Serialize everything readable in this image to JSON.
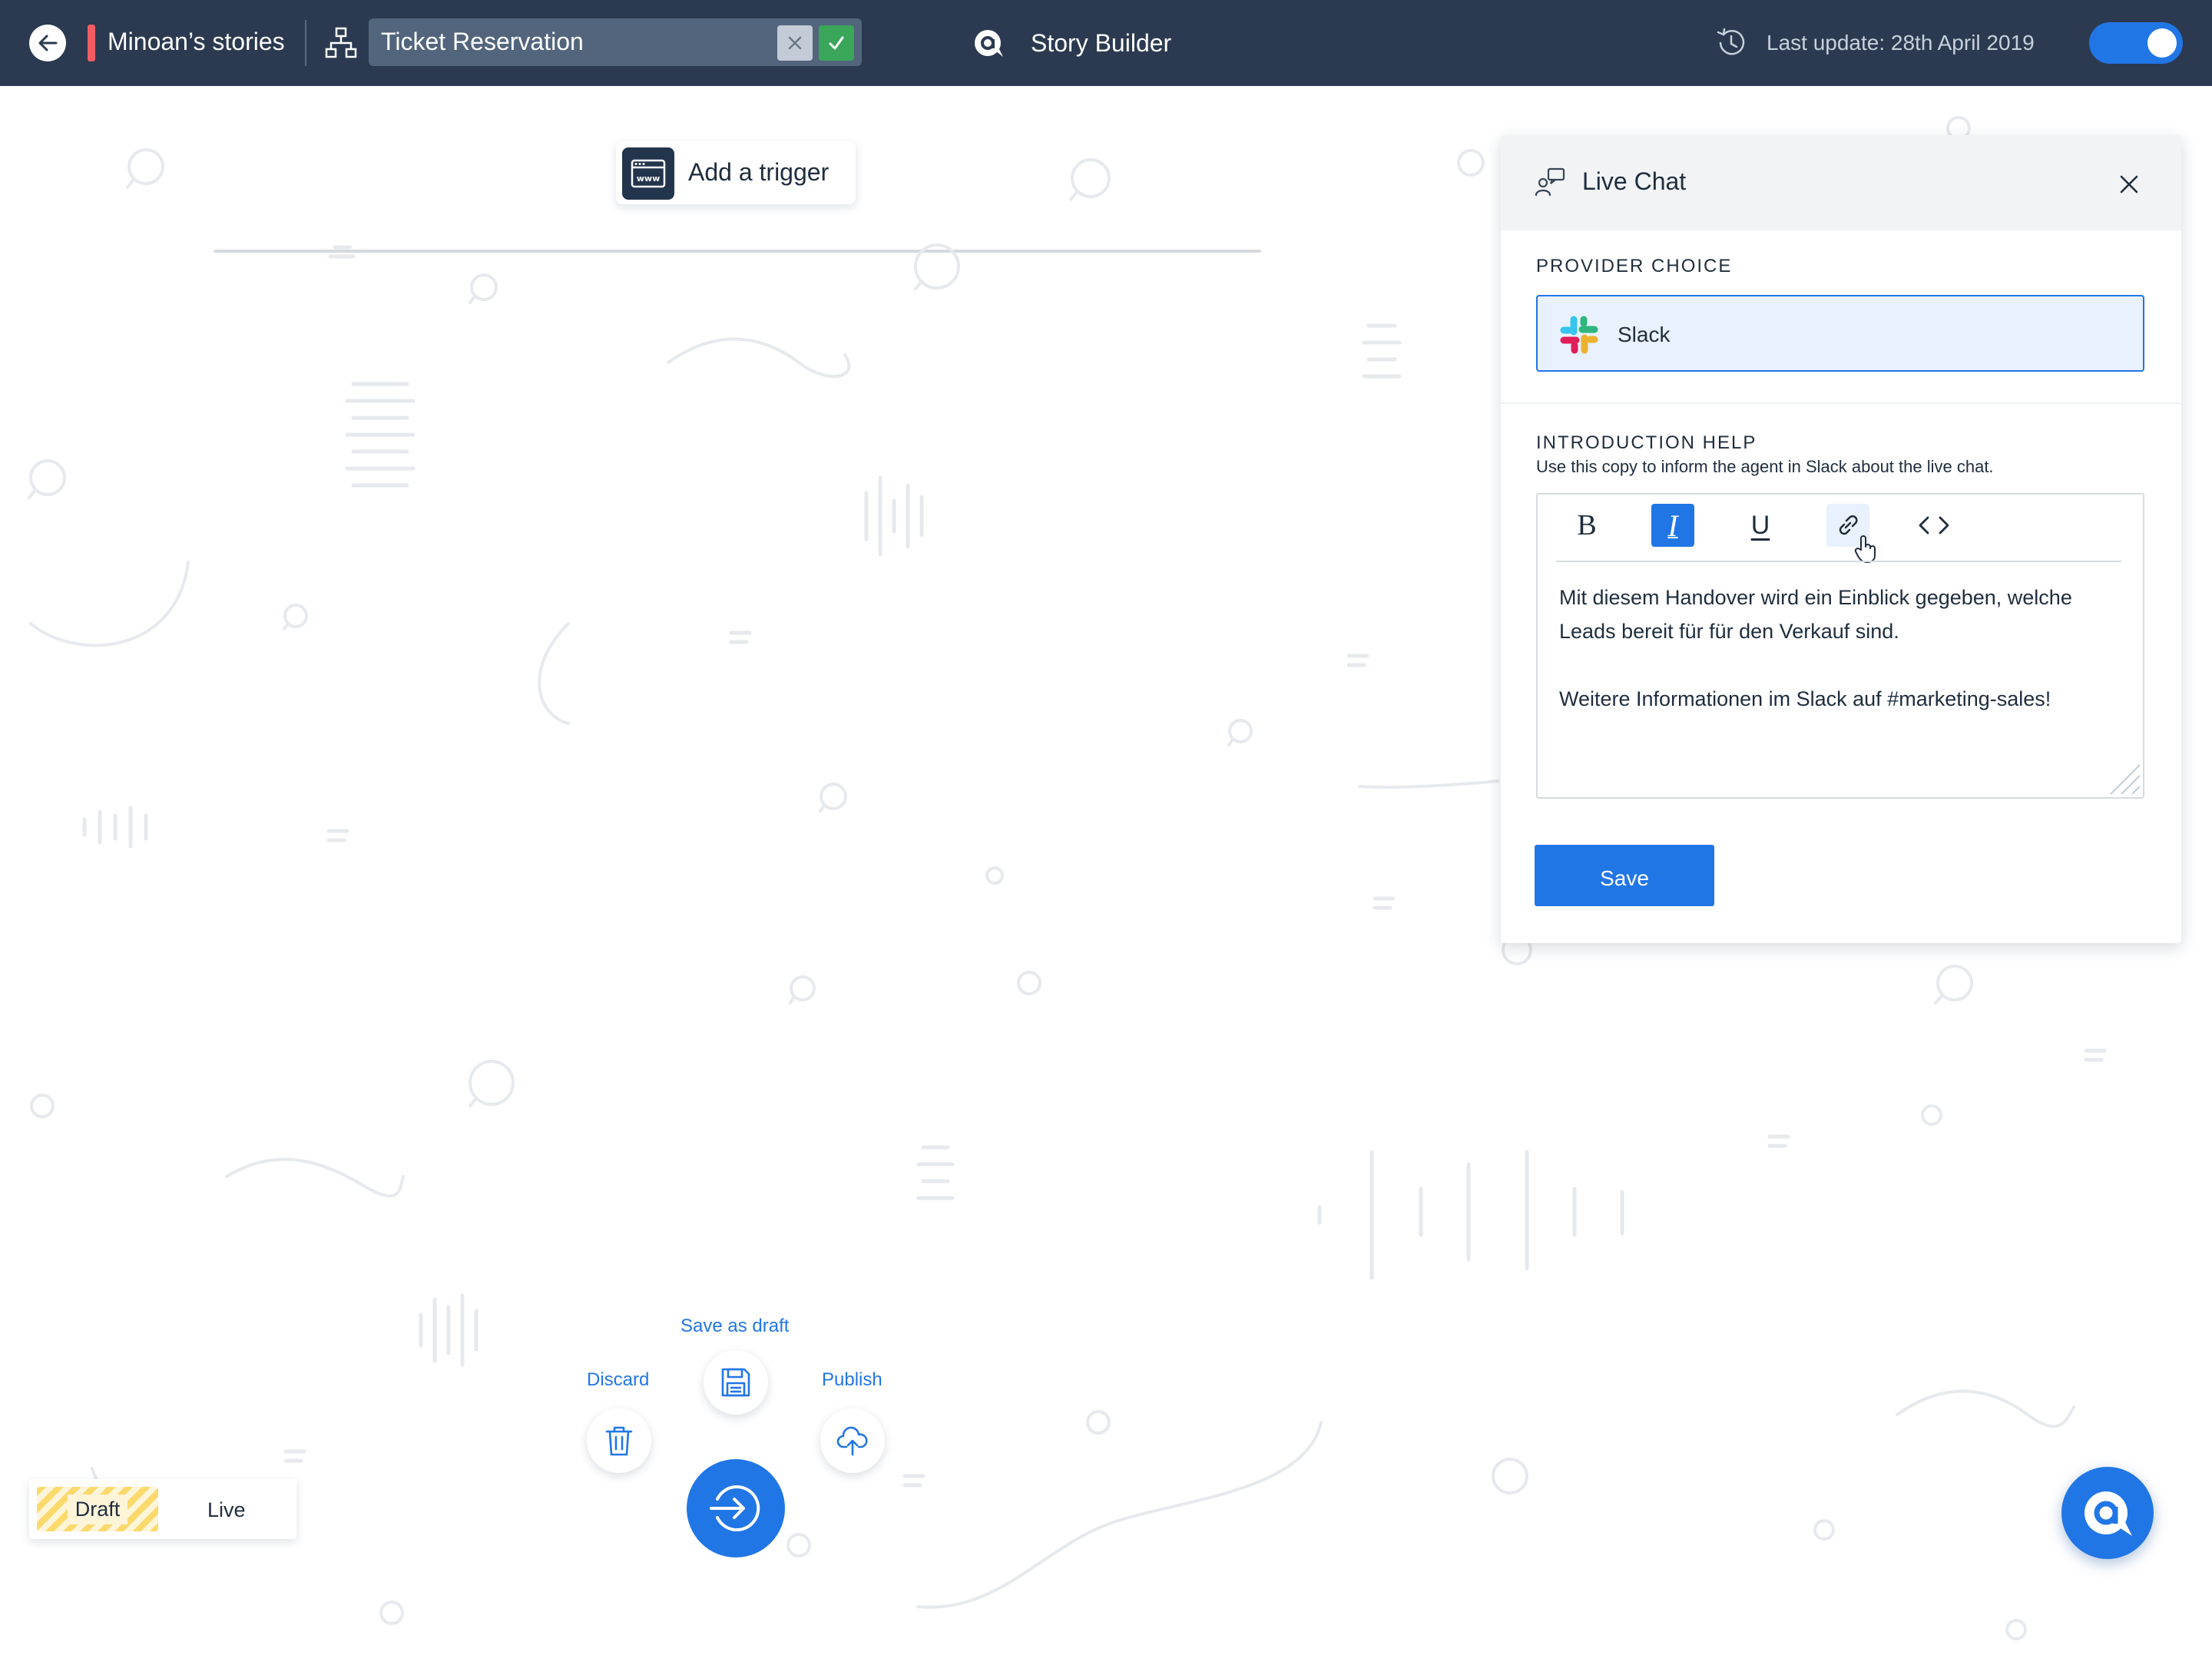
{
  "topbar": {
    "story_name": "Minoan’s stories",
    "ticket_name": "Ticket Reservation",
    "app_title": "Story Builder",
    "last_update": "Last update: 28th April 2019",
    "live_toggle_on": true
  },
  "canvas": {
    "trigger_label": "Add a trigger"
  },
  "panel": {
    "title": "Live Chat",
    "provider_section": "PROVIDER CHOICE",
    "provider_selected": "Slack",
    "intro_section": "INTRODUCTION HELP",
    "intro_description": "Use this copy to inform the agent in Slack about the live chat.",
    "toolbar": {
      "bold": "B",
      "italic": "I",
      "underline": "U"
    },
    "editor_lines": [
      "Mit diesem Handover wird ein Einblick gegeben, welche",
      "Leads bereit für für den Verkauf sind.",
      "",
      "Weitere Informationen im Slack auf #marketing-sales!"
    ],
    "save_label": "Save"
  },
  "actions": {
    "save_draft": "Save as draft",
    "discard": "Discard",
    "publish": "Publish"
  },
  "mode_switch": {
    "draft": "Draft",
    "live": "Live"
  },
  "colors": {
    "topbar": "#2b3a50",
    "accent": "#2176e6",
    "confirm": "#3aa65a",
    "story_marker": "#f25c63",
    "draft_stripes": "#fbd96b"
  },
  "icons": {
    "back": "arrow-left-icon",
    "flow": "sitemap-icon",
    "logo": "chat-bubble-a-icon",
    "history": "history-icon",
    "trigger": "browser-www-icon",
    "live_chat": "agent-chat-icon",
    "close": "close-icon",
    "slack": "slack-logo",
    "link": "link-icon",
    "code": "code-icon",
    "save_draft": "floppy-disk-icon",
    "discard": "trash-icon",
    "publish": "cloud-upload-icon",
    "enter": "sign-in-icon"
  }
}
